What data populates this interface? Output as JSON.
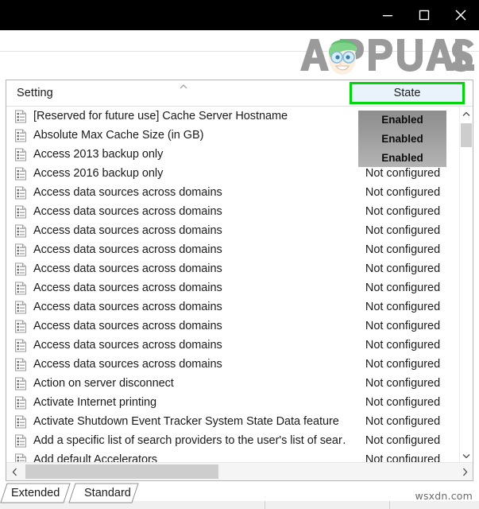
{
  "window": {
    "titlebar": {
      "minimize_label": "Minimize",
      "maximize_label": "Maximize",
      "close_label": "Close"
    },
    "branding": {
      "logo_text": "APPUALS"
    }
  },
  "colors": {
    "titlebar_bg": "#000000",
    "highlight_green": "#00d60a",
    "header_selected_bg": "#e8f3fb",
    "overlay_gray": "#9b9b9b",
    "text": "#1b1b1b",
    "logo_gray": "#9a9a9a",
    "logo_hair_green": "#7ed389"
  },
  "list": {
    "columns": [
      {
        "key": "setting",
        "label": "Setting",
        "sort": "ascending"
      },
      {
        "key": "state",
        "label": "State",
        "highlighted": true
      }
    ],
    "rows": [
      {
        "icon": "policy-setting-icon",
        "setting": "[Reserved for future use] Cache Server Hostname",
        "state": "Enabled",
        "overlay": true
      },
      {
        "icon": "policy-setting-icon",
        "setting": "Absolute Max Cache Size (in GB)",
        "state": "Enabled",
        "overlay": true
      },
      {
        "icon": "policy-setting-icon",
        "setting": "Access 2013 backup only",
        "state": "Enabled",
        "overlay": true
      },
      {
        "icon": "policy-setting-icon",
        "setting": "Access 2016 backup only",
        "state": "Not configured",
        "overlay": false
      },
      {
        "icon": "policy-setting-icon",
        "setting": "Access data sources across domains",
        "state": "Not configured",
        "overlay": false
      },
      {
        "icon": "policy-setting-icon",
        "setting": "Access data sources across domains",
        "state": "Not configured",
        "overlay": false
      },
      {
        "icon": "policy-setting-icon",
        "setting": "Access data sources across domains",
        "state": "Not configured",
        "overlay": false
      },
      {
        "icon": "policy-setting-icon",
        "setting": "Access data sources across domains",
        "state": "Not configured",
        "overlay": false
      },
      {
        "icon": "policy-setting-icon",
        "setting": "Access data sources across domains",
        "state": "Not configured",
        "overlay": false
      },
      {
        "icon": "policy-setting-icon",
        "setting": "Access data sources across domains",
        "state": "Not configured",
        "overlay": false
      },
      {
        "icon": "policy-setting-icon",
        "setting": "Access data sources across domains",
        "state": "Not configured",
        "overlay": false
      },
      {
        "icon": "policy-setting-icon",
        "setting": "Access data sources across domains",
        "state": "Not configured",
        "overlay": false
      },
      {
        "icon": "policy-setting-icon",
        "setting": "Access data sources across domains",
        "state": "Not configured",
        "overlay": false
      },
      {
        "icon": "policy-setting-icon",
        "setting": "Access data sources across domains",
        "state": "Not configured",
        "overlay": false
      },
      {
        "icon": "policy-setting-icon",
        "setting": "Action on server disconnect",
        "state": "Not configured",
        "overlay": false
      },
      {
        "icon": "policy-setting-icon",
        "setting": "Activate Internet printing",
        "state": "Not configured",
        "overlay": false
      },
      {
        "icon": "policy-setting-icon",
        "setting": "Activate Shutdown Event Tracker System State Data feature",
        "state": "Not configured",
        "overlay": false
      },
      {
        "icon": "policy-setting-icon",
        "setting": "Add a specific list of search providers to the user's list of sear…",
        "state": "Not configured",
        "overlay": false
      },
      {
        "icon": "policy-setting-icon",
        "setting": "Add default Accelerators",
        "state": "Not configured",
        "overlay": false
      }
    ],
    "overlay_values": [
      "Enabled",
      "Enabled",
      "Enabled"
    ],
    "scrollbars": {
      "vertical": {
        "up_label": "Scroll up",
        "down_label": "Scroll down"
      },
      "horizontal": {
        "left_label": "Scroll left",
        "right_label": "Scroll right"
      }
    }
  },
  "tabs": [
    {
      "label": "Extended",
      "selected": false
    },
    {
      "label": "Standard",
      "selected": true
    }
  ],
  "watermark": {
    "text": "wsxdn.com"
  }
}
